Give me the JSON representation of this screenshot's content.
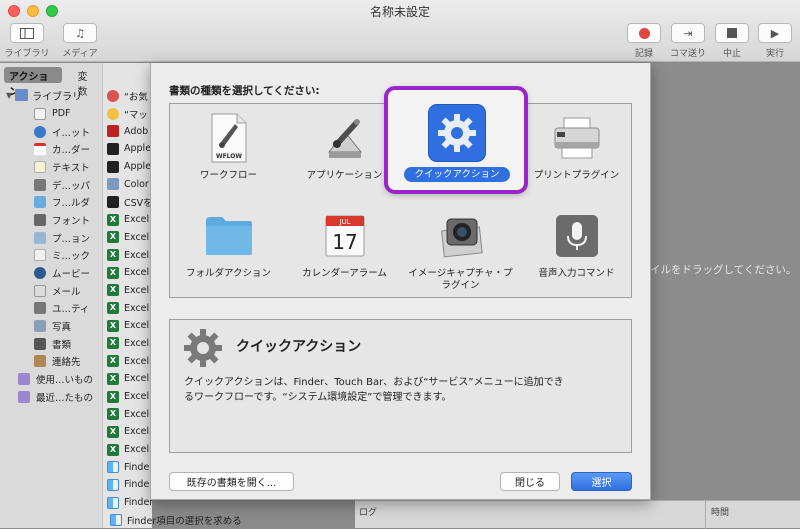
{
  "window": {
    "title": "名称未設定"
  },
  "toolbar": {
    "library_label": "ライブラリ",
    "media_label": "メディア",
    "record_label": "記録",
    "step_label": "コマ送り",
    "stop_label": "中止",
    "run_label": "実行"
  },
  "sidebar": {
    "tabs": [
      "アクション",
      "変数"
    ],
    "library_label": "ライブラリ",
    "items": [
      {
        "label": "PDF",
        "icon": "pdf-icon"
      },
      {
        "label": "イ…ット",
        "icon": "internet-icon"
      },
      {
        "label": "カ…ダー",
        "icon": "calendar-icon"
      },
      {
        "label": "テキスト",
        "icon": "text-icon"
      },
      {
        "label": "デ…ッパ",
        "icon": "developer-icon"
      },
      {
        "label": "フ…ルダ",
        "icon": "folder-icon"
      },
      {
        "label": "フォント",
        "icon": "font-icon"
      },
      {
        "label": "プ…ョン",
        "icon": "presentation-icon"
      },
      {
        "label": "ミ…ック",
        "icon": "music-icon"
      },
      {
        "label": "ムービー",
        "icon": "movie-icon"
      },
      {
        "label": "メール",
        "icon": "mail-icon"
      },
      {
        "label": "ユ…ティ",
        "icon": "utility-icon"
      },
      {
        "label": "写真",
        "icon": "photo-icon"
      },
      {
        "label": "書類",
        "icon": "document-icon"
      },
      {
        "label": "連絡先",
        "icon": "contacts-icon"
      }
    ],
    "smart_items": [
      {
        "label": "使用…いもの",
        "icon": "smart-folder-icon"
      },
      {
        "label": "最近…たもの",
        "icon": "smart-folder-icon"
      }
    ]
  },
  "actions": {
    "items": [
      "“お気",
      "“マッ",
      "Adob",
      "Apple",
      "Apple",
      "Color",
      "CSVを",
      "Excel",
      "Excel",
      "Excel",
      "Excel",
      "Excel",
      "Excel",
      "Excel",
      "Excel",
      "Excel",
      "Excel",
      "Excel",
      "Excel",
      "Excel",
      "Excel",
      "Finder",
      "Finder",
      "Finder",
      "Finder項目の選択を求める"
    ]
  },
  "background": {
    "drag_hint": "イルをドラッグしてください。",
    "log_col": "ログ",
    "time_col": "時間"
  },
  "dialog": {
    "prompt": "書類の種類を選択してください:",
    "types": [
      {
        "label": "ワークフロー",
        "icon": "workflow-icon",
        "badge": "WFLOW"
      },
      {
        "label": "アプリケーション",
        "icon": "application-icon"
      },
      {
        "label": "クイックアクション",
        "icon": "quick-action-icon",
        "selected": true
      },
      {
        "label": "プリントプラグイン",
        "icon": "printer-icon"
      },
      {
        "label": "フォルダアクション",
        "icon": "folder-icon"
      },
      {
        "label": "カレンダーアラーム",
        "icon": "calendar-icon",
        "month": "JUL",
        "day": "17"
      },
      {
        "label": "イメージキャプチャ・プラグイン",
        "icon": "camera-icon"
      },
      {
        "label": "音声入力コマンド",
        "icon": "microphone-icon"
      }
    ],
    "selected_label": "クイックアクション",
    "description_title": "クイックアクション",
    "description_line1": "クイックアクションは、Finder、Touch Bar、および“サービス”メニューに追加でき",
    "description_line2": "るワークフローです。“システム環境設定”で管理できます。",
    "open_existing_label": "既存の書類を開く...",
    "close_label": "閉じる",
    "choose_label": "選択"
  },
  "colors": {
    "accent": "#2f6fe0",
    "selection_ring": "#9b25c9"
  }
}
